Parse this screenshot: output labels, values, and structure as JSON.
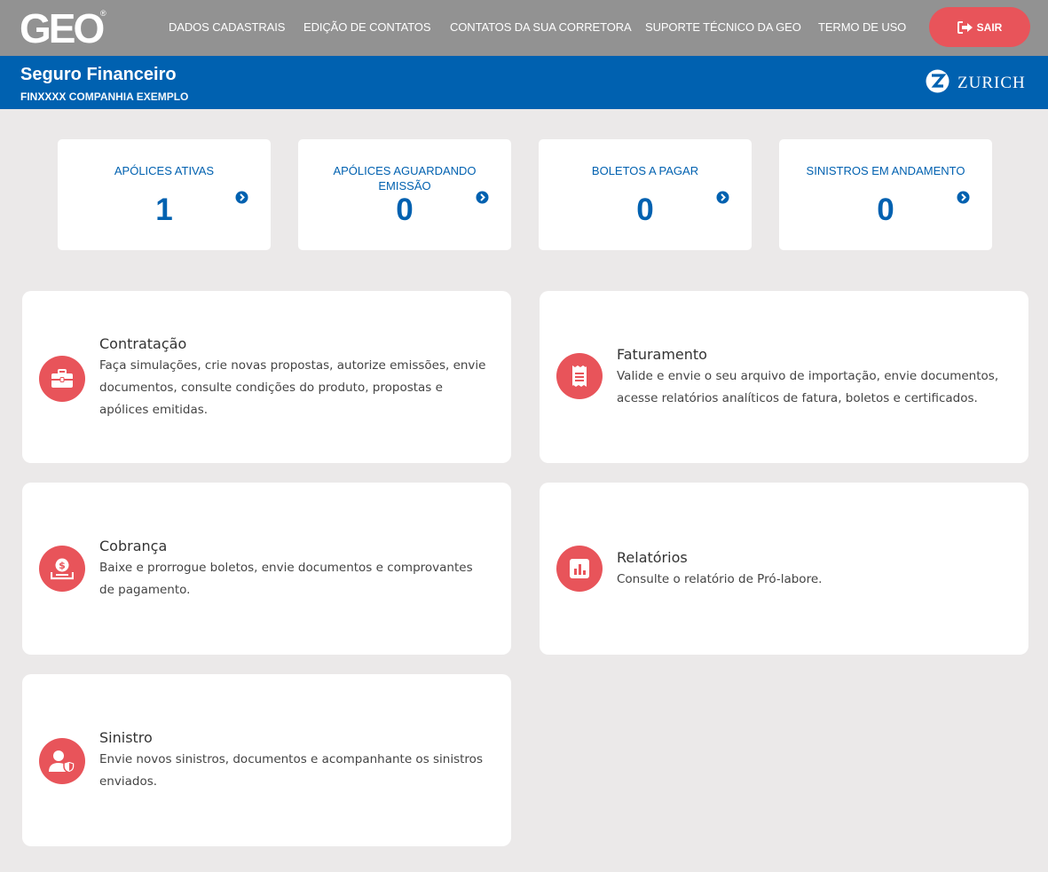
{
  "nav": {
    "logo_text": "GEO",
    "logo_mark": "®",
    "items": [
      {
        "label": "DADOS CADASTRAIS"
      },
      {
        "label": "EDIÇÃO DE CONTATOS"
      },
      {
        "label": "CONTATOS DA SUA CORRETORA"
      },
      {
        "label": "SUPORTE TÉCNICO DA GEO"
      },
      {
        "label": "TERMO DE USO"
      }
    ],
    "logout_label": "SAIR",
    "logout_icon": "sign-out-icon"
  },
  "header": {
    "title": "Seguro Financeiro",
    "code": "FINXXXX",
    "company": "COMPANHIA EXEMPLO",
    "brand": "ZURICH",
    "brand_icon": "zurich-z-icon"
  },
  "stats": [
    {
      "label": "APÓLICES ATIVAS",
      "value": "1"
    },
    {
      "label": "APÓLICES AGUARDANDO EMISSÃO",
      "value": "0"
    },
    {
      "label": "BOLETOS A PAGAR",
      "value": "0"
    },
    {
      "label": "SINISTROS EM ANDAMENTO",
      "value": "0"
    }
  ],
  "features": [
    {
      "title": "Contratação",
      "description": "Faça simulações, crie novas propostas, autorize emissões, envie documentos, consulte condições do produto, propostas e apólices emitidas.",
      "icon": "briefcase-icon"
    },
    {
      "title": "Faturamento",
      "description": "Valide e envie o seu arquivo de importação, envie documentos, acesse relatórios analíticos de fatura, boletos e certificados.",
      "icon": "receipt-icon"
    },
    {
      "title": "Cobrança",
      "description": "Baixe e prorrogue boletos, envie documentos e comprovantes de pagamento.",
      "icon": "money-tray-icon"
    },
    {
      "title": "Relatórios",
      "description": "Consulte o relatório de Pró-labore.",
      "icon": "bar-chart-icon"
    },
    {
      "title": "Sinistro",
      "description": "Envie novos sinistros, documentos e acompanhante os sinistros enviados.",
      "icon": "user-shield-icon"
    }
  ],
  "colors": {
    "nav_bg": "#929292",
    "header_bg": "#0061b0",
    "accent": "#e8545a",
    "page_bg": "#ebe9e9"
  }
}
